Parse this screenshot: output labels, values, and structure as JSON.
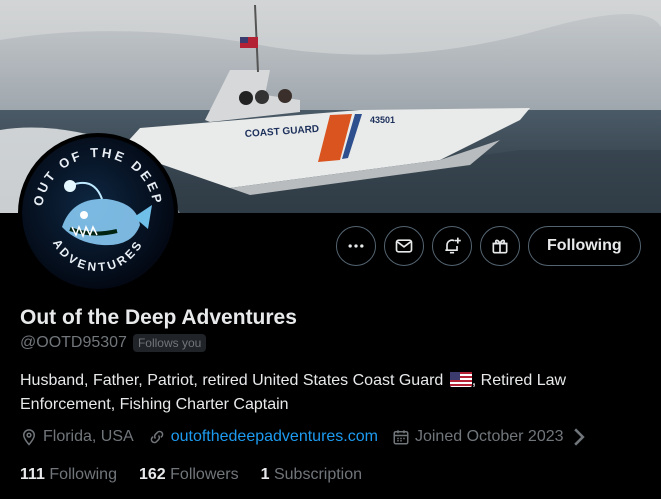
{
  "profile": {
    "display_name": "Out of the Deep Adventures",
    "handle": "@OOTD95307",
    "follows_you_badge": "Follows you",
    "bio_line1": "Husband, Father, Patriot, retired United States Coast Guard",
    "bio_line2": ", Retired Law Enforcement, Fishing Charter Captain",
    "location": "Florida, USA",
    "website": "outofthedeepadventures.com",
    "joined": "Joined October 2023"
  },
  "banner": {
    "boat_hull_text": "COAST GUARD",
    "boat_number": "43501"
  },
  "avatar": {
    "logo_text_top": "OUT OF THE DEEP",
    "logo_text_bottom": "ADVENTURES"
  },
  "actions": {
    "more_icon": "more-horizontal-icon",
    "message_icon": "envelope-icon",
    "notify_icon": "bell-plus-icon",
    "subscribe_icon": "gift-icon",
    "following_label": "Following"
  },
  "stats": {
    "following_count": "111",
    "following_label": "Following",
    "followers_count": "162",
    "followers_label": "Followers",
    "subscription_count": "1",
    "subscription_label": "Subscription"
  },
  "colors": {
    "background": "#000000",
    "text_primary": "#e7e9ea",
    "text_secondary": "#71767b",
    "link": "#1d9bf0",
    "border": "#536471"
  }
}
